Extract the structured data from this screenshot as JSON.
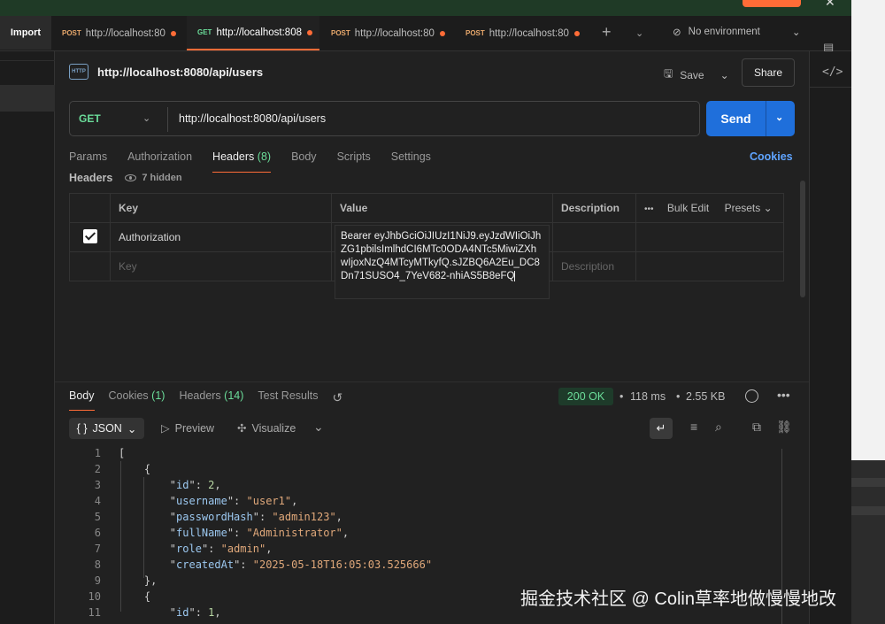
{
  "tabs": {
    "import_label": "Import",
    "items": [
      {
        "method": "POST",
        "label": "http://localhost:80",
        "active": false
      },
      {
        "method": "GET",
        "label": "http://localhost:808",
        "active": true
      },
      {
        "method": "POST",
        "label": "http://localhost:80",
        "active": false
      },
      {
        "method": "POST",
        "label": "http://localhost:80",
        "active": false
      }
    ],
    "environment": "No environment"
  },
  "request": {
    "title": "http://localhost:8080/api/users",
    "save_label": "Save",
    "share_label": "Share",
    "method": "GET",
    "url": "http://localhost:8080/api/users",
    "send_label": "Send",
    "cookies_label": "Cookies"
  },
  "req_tabs": [
    {
      "label": "Params",
      "count": ""
    },
    {
      "label": "Authorization",
      "count": ""
    },
    {
      "label": "Headers",
      "count": "(8)",
      "active": true
    },
    {
      "label": "Body",
      "count": ""
    },
    {
      "label": "Scripts",
      "count": ""
    },
    {
      "label": "Settings",
      "count": ""
    }
  ],
  "headers_section": {
    "label": "Headers",
    "hidden": "7 hidden",
    "col_key": "Key",
    "col_value": "Value",
    "col_desc": "Description",
    "bulk_edit": "Bulk Edit",
    "presets": "Presets",
    "row": {
      "key": "Authorization",
      "value": "Bearer eyJhbGciOiJIUzI1NiJ9.eyJzdWIiOiJhZG1pbilsImlhdCI6MTc0ODA4NTc5MiwiZXhwIjoxNzQ4MTcyMTkyfQ.sJZBQ6A2Eu_DC8Dn71SUSO4_7YeV682-nhiAS5B8eFQ"
    },
    "placeholder_key": "Key",
    "placeholder_desc": "Description"
  },
  "response": {
    "tabs": [
      {
        "label": "Body",
        "count": "",
        "active": true
      },
      {
        "label": "Cookies",
        "count": "(1)"
      },
      {
        "label": "Headers",
        "count": "(14)"
      },
      {
        "label": "Test Results",
        "count": ""
      }
    ],
    "status": "200 OK",
    "time": "118 ms",
    "size": "2.55 KB",
    "format": "JSON",
    "preview": "Preview",
    "visualize": "Visualize",
    "lines": [
      {
        "n": "1",
        "t": "["
      },
      {
        "n": "2",
        "t": "    {"
      },
      {
        "n": "3",
        "k": "id",
        "v": "2",
        "vt": "num",
        "comma": true
      },
      {
        "n": "4",
        "k": "username",
        "v": "\"user1\"",
        "vt": "str",
        "comma": true
      },
      {
        "n": "5",
        "k": "passwordHash",
        "v": "\"admin123\"",
        "vt": "str",
        "comma": true
      },
      {
        "n": "6",
        "k": "fullName",
        "v": "\"Administrator\"",
        "vt": "str",
        "comma": true
      },
      {
        "n": "7",
        "k": "role",
        "v": "\"admin\"",
        "vt": "str",
        "comma": true
      },
      {
        "n": "8",
        "k": "createdAt",
        "v": "\"2025-05-18T16:05:03.525666\"",
        "vt": "str",
        "comma": false
      },
      {
        "n": "9",
        "t": "    },"
      },
      {
        "n": "10",
        "t": "    {"
      },
      {
        "n": "11",
        "k": "id",
        "v": "1",
        "vt": "num",
        "comma": true
      }
    ]
  },
  "watermark": "掘金技术社区 @ Colin草率地做慢慢地改"
}
